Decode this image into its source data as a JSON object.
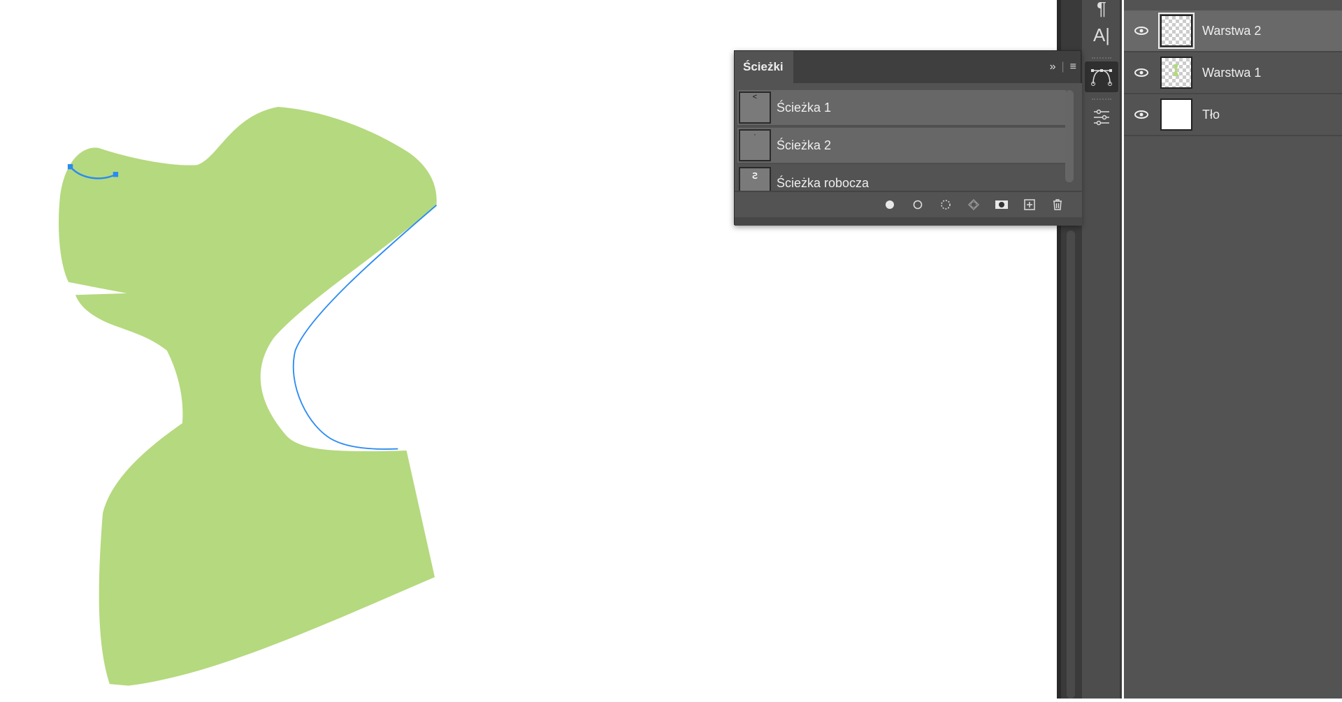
{
  "colors": {
    "shape_fill": "#b5d97e",
    "path_stroke": "#2a8bf2",
    "panel_bg": "#535353",
    "selected_row": "#696969"
  },
  "paths_panel": {
    "tab_label": "Ścieżki",
    "collapse_icon": "double-chevron-right-icon",
    "menu_icon": "hamburger-menu-icon",
    "items": [
      {
        "label": "Ścieżka 1"
      },
      {
        "label": "Ścieżka 2"
      },
      {
        "label": "Ścieżka robocza"
      }
    ],
    "footer_buttons": [
      "fill-path-icon",
      "stroke-path-icon",
      "load-selection-icon",
      "make-work-path-icon",
      "add-mask-icon",
      "new-path-icon",
      "trash-icon"
    ]
  },
  "tools": [
    "paragraph-icon",
    "character-icon",
    "paths-icon",
    "adjustments-icon"
  ],
  "layers": {
    "items": [
      {
        "label": "Warstwa 2",
        "selected": true
      },
      {
        "label": "Warstwa 1"
      },
      {
        "label": "Tło"
      }
    ]
  }
}
